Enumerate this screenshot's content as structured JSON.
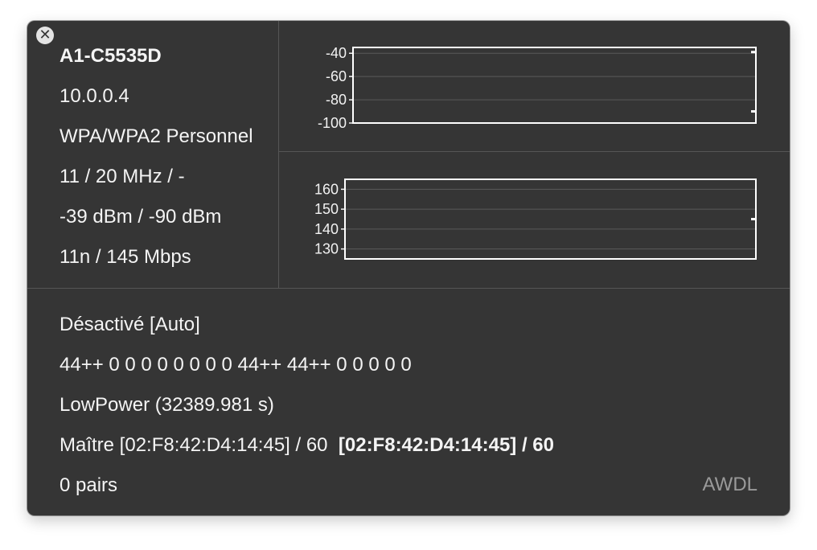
{
  "window": {
    "close_icon": "close-icon",
    "close_glyph": "✕"
  },
  "network": {
    "name": "A1-C5535D",
    "ip": "10.0.0.4",
    "security": "WPA/WPA2 Personnel",
    "channel": "11 / 20 MHz / -",
    "signal_noise": "-39 dBm / -90 dBm",
    "phy_rate": "11n / 145 Mbps"
  },
  "charts": {
    "signal": {
      "ticks": [
        -40,
        -60,
        -80,
        -100
      ],
      "ylim": [
        -100,
        -35
      ],
      "markers": [
        -39,
        -90
      ]
    },
    "rate": {
      "ticks": [
        160,
        150,
        140,
        130
      ],
      "ylim": [
        125,
        165
      ],
      "markers": [
        145
      ]
    }
  },
  "chart_data": [
    {
      "type": "line",
      "title": "",
      "xlabel": "",
      "ylabel": "",
      "ylim": [
        -100,
        -35
      ],
      "yticks": [
        -40,
        -60,
        -80,
        -100
      ],
      "grid": true,
      "series": [
        {
          "values": [
            -39
          ]
        },
        {
          "values": [
            -90
          ]
        }
      ]
    },
    {
      "type": "line",
      "title": "",
      "xlabel": "",
      "ylabel": "",
      "ylim": [
        125,
        165
      ],
      "yticks": [
        160,
        150,
        140,
        130
      ],
      "grid": true,
      "series": [
        {
          "values": [
            145
          ]
        }
      ]
    }
  ],
  "awdl": {
    "status": "Désactivé [Auto]",
    "channel_sequence": "44++ 0 0 0 0 0 0 0 0 44++ 44++ 0 0 0 0 0",
    "power_state": "LowPower (32389.981 s)",
    "master_prefix": "Maître [02:F8:42:D4:14:45] / 60",
    "master_bold": "[02:F8:42:D4:14:45] / 60",
    "peers": "0 pairs",
    "label": "AWDL"
  }
}
